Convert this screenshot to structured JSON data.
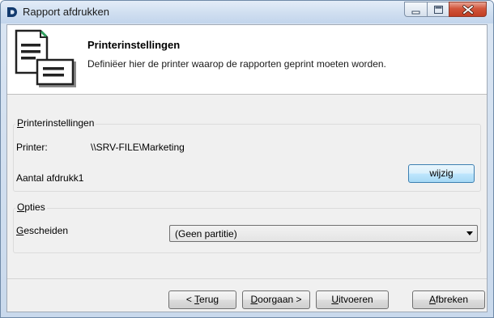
{
  "window": {
    "title": "Rapport afdrukken",
    "controls": {
      "minimize": "minimize-icon",
      "maximize": "maximize-icon",
      "close": "close-icon"
    }
  },
  "header": {
    "title": "Printerinstellingen",
    "description": "Definiëer hier de printer waarop de rapporten geprint moeten worden.",
    "icon": "document-printer-icon"
  },
  "printer_group": {
    "legend_mnemonic": "P",
    "legend_rest": "rinterinstellingen",
    "printer_label": "Printer:",
    "printer_value": "\\\\SRV-FILE\\Marketing",
    "copies_label": "Aantal afdrukk1",
    "change_button": "wijzig"
  },
  "options_group": {
    "legend_mnemonic": "O",
    "legend_rest": "pties",
    "split_label_mnemonic": "G",
    "split_label_rest": "escheiden",
    "split_selected": "(Geen partitie)"
  },
  "buttons": {
    "back_prefix": "< ",
    "back_mnemonic": "T",
    "back_rest": "erug",
    "next_mnemonic": "D",
    "next_rest": "oorgaan >",
    "run_mnemonic": "U",
    "run_rest": "itvoeren",
    "cancel_mnemonic": "A",
    "cancel_rest": "fbreken"
  },
  "colors": {
    "accent": "#3c7fb1",
    "close_button": "#c13d22",
    "dialog_background": "#f0f0f0"
  }
}
